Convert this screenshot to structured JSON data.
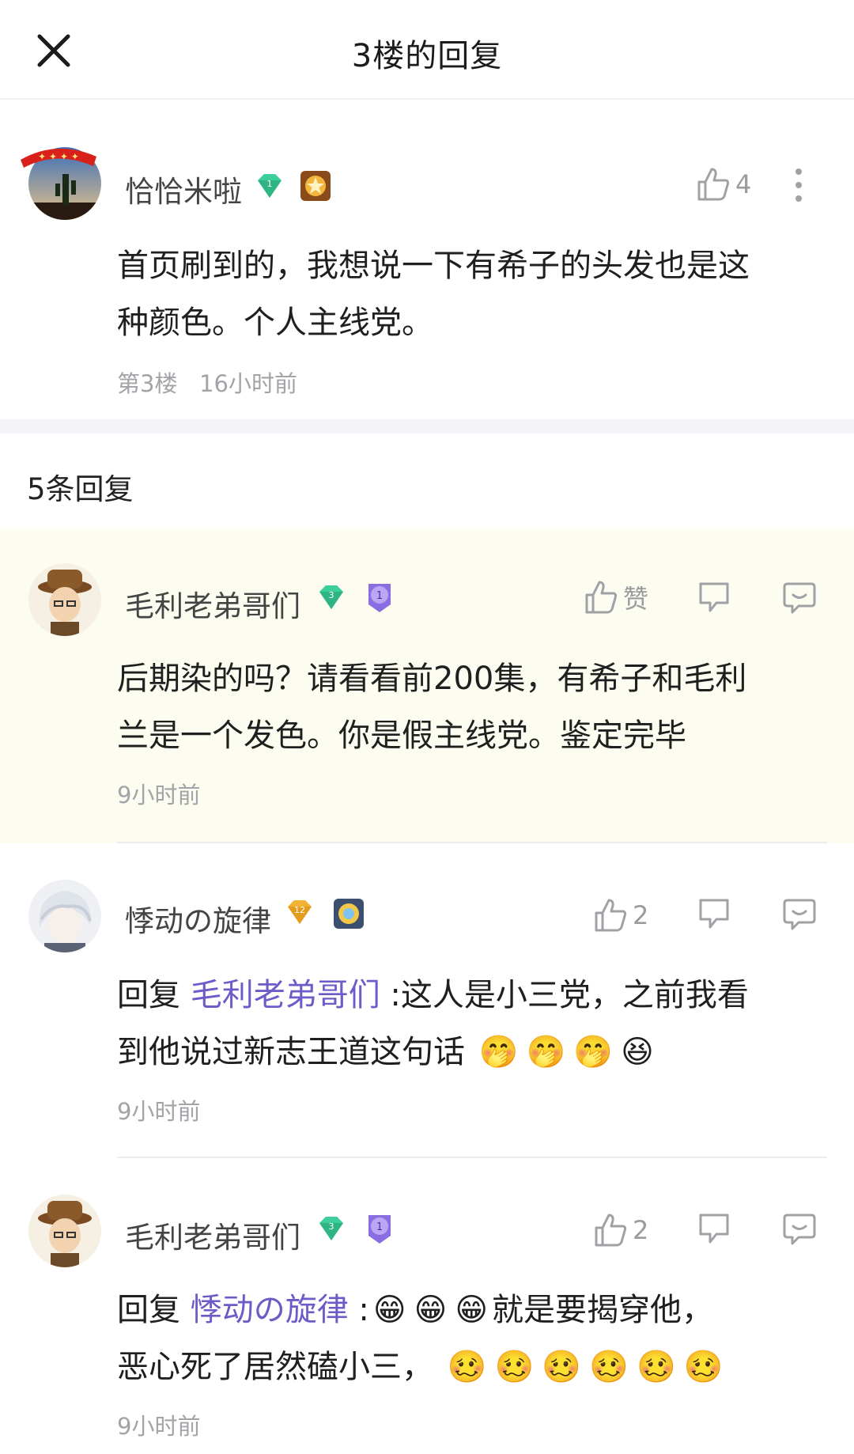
{
  "header": {
    "title": "3楼的回复",
    "close_icon": "close-icon"
  },
  "main_comment": {
    "username": "恰恰米啦",
    "level": "1",
    "likes": "4",
    "text_lines": [
      "首页刷到的，我想说一下有希子的头发也是这",
      "种颜色。个人主线党。"
    ],
    "floor": "第3楼",
    "time": "16小时前"
  },
  "replies_header": "5条回复",
  "replies": [
    {
      "username": "毛利老弟哥们",
      "level": "3",
      "medal": "1",
      "like_label": "赞",
      "text_lines": [
        "后期染的吗？请看看前200集，有希子和毛利",
        "兰是一个发色。你是假主线党。鉴定完毕"
      ],
      "time": "9小时前"
    },
    {
      "username": "悸动の旋律",
      "level": "12",
      "like_label": "2",
      "reply_prefix": "回复 ",
      "mention": "毛利老弟哥们",
      "text_line1_rest": " :这人是小三党，之前我看",
      "text_line2": "到他说过新志王道这句话",
      "emojis_line2": [
        "🤭",
        "🤭",
        "🤭",
        "😆"
      ],
      "time": "9小时前"
    },
    {
      "username": "毛利老弟哥们",
      "level": "3",
      "medal": "1",
      "like_label": "2",
      "reply_prefix": "回复 ",
      "mention": "悸动の旋律",
      "text_line1_sep": " :",
      "emojis_line1": [
        "😁",
        "😁",
        "😁"
      ],
      "text_line1_rest": "就是要揭穿他，",
      "text_line2": "恶心死了居然磕小三，",
      "emojis_line2": [
        "🥴",
        "🥴",
        "🥴",
        "🥴",
        "🥴",
        "🥴"
      ],
      "time": "9小时前"
    }
  ],
  "colors": {
    "mention": "#6b5cc8",
    "gem_green": "#3ccf9b",
    "gem_gold": "#f2b233",
    "highlight": "#fdfcf0"
  }
}
